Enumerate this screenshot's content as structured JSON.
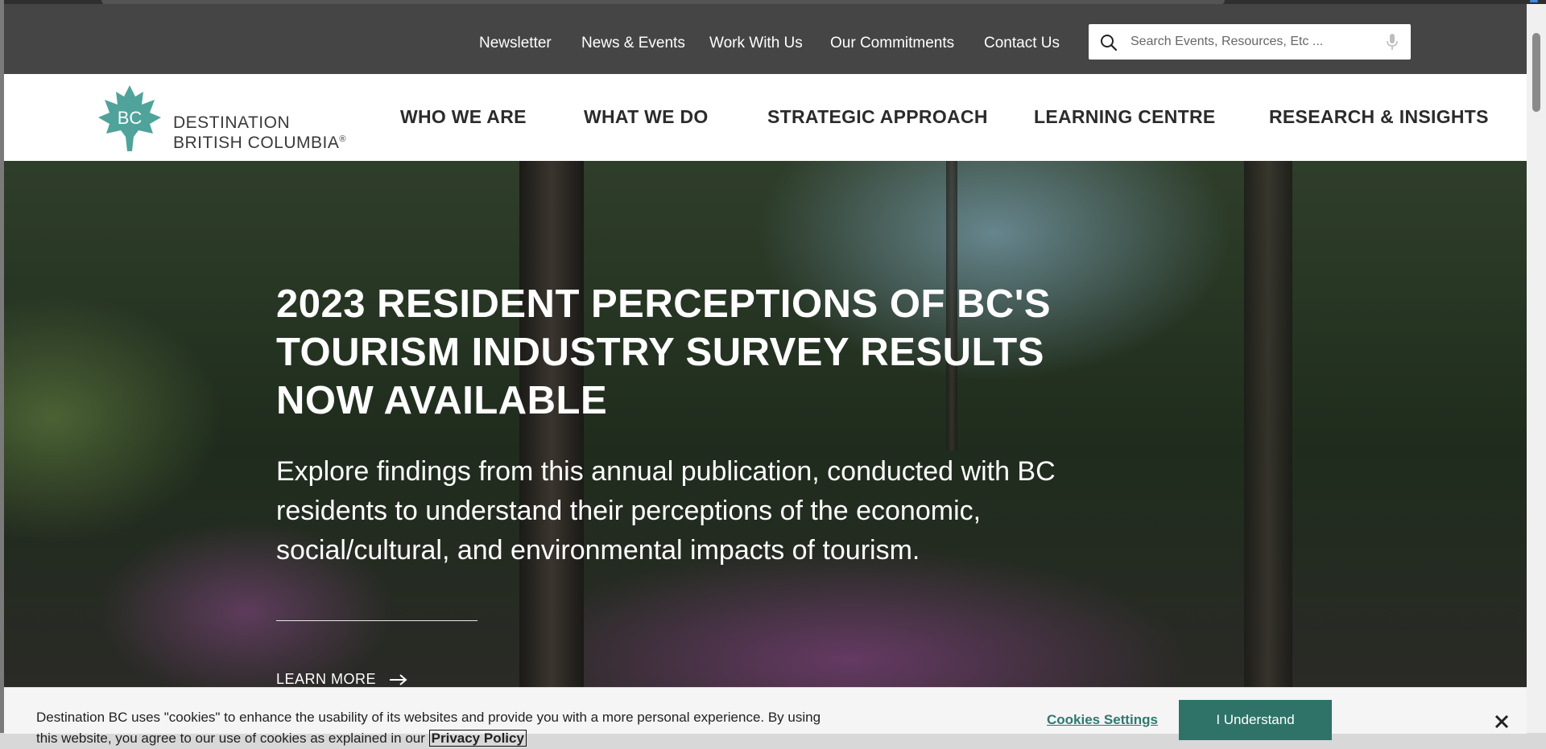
{
  "utility_nav": {
    "links": [
      "Newsletter",
      "News & Events",
      "Work With Us",
      "Our Commitments",
      "Contact Us"
    ],
    "search_placeholder": "Search Events, Resources, Etc ..."
  },
  "brand": {
    "logo_monogram": "BC",
    "name_line1": "DESTINATION",
    "name_line2": "BRITISH COLUMBIA",
    "registered_mark": "®",
    "logo_color": "#4fa39a"
  },
  "main_nav": {
    "items": [
      "WHO WE ARE",
      "WHAT WE DO",
      "STRATEGIC APPROACH",
      "LEARNING CENTRE",
      "RESEARCH & INSIGHTS"
    ]
  },
  "hero": {
    "title": "2023 RESIDENT PERCEPTIONS OF BC'S TOURISM INDUSTRY SURVEY RESULTS NOW AVAILABLE",
    "description": "Explore findings from this annual publication, conducted with BC residents to understand their perceptions of the economic, social/cultural, and environmental impacts of tourism.",
    "cta_label": "LEARN MORE"
  },
  "cookie_banner": {
    "text": "Destination BC uses \"cookies\" to enhance the usability of its websites and provide you with a more personal experience. By using",
    "text_line2": "this website, you agree to our use of cookies as explained in our",
    "policy_link": "Privacy Policy",
    "settings_label": "Cookies Settings",
    "accept_label": "I Understand",
    "accent_color": "#2f7268"
  }
}
